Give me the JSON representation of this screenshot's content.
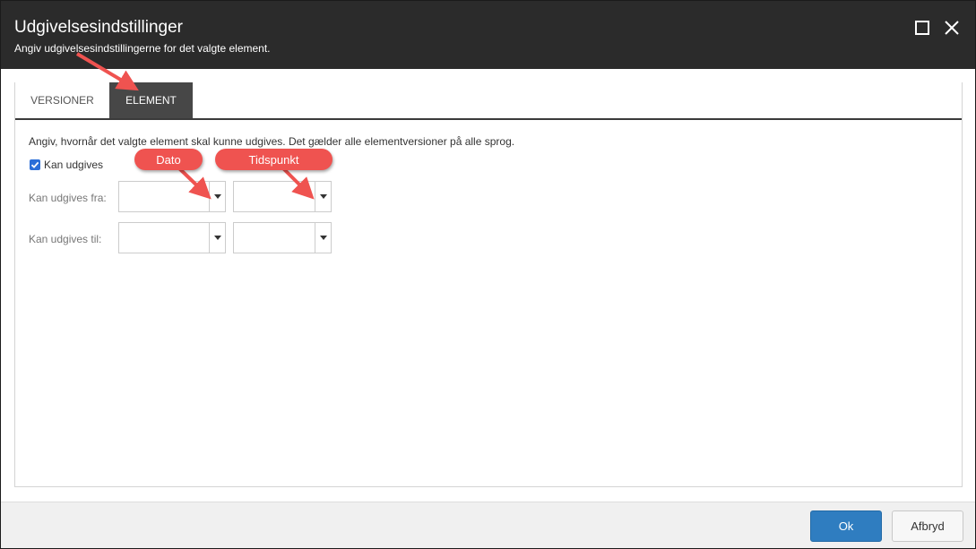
{
  "window": {
    "title": "Udgivelsesindstillinger",
    "subtitle": "Angiv udgivelsesindstillingerne for det valgte element."
  },
  "tabs": [
    {
      "label": "VERSIONER",
      "active": false
    },
    {
      "label": "ELEMENT",
      "active": true
    }
  ],
  "main": {
    "description": "Angiv, hvornår det valgte element skal kunne udgives. Det gælder alle elementversioner på alle sprog.",
    "publishable": {
      "label": "Kan udgives",
      "checked": true
    },
    "from": {
      "label": "Kan udgives fra:",
      "date": "",
      "time": ""
    },
    "to": {
      "label": "Kan udgives til:",
      "date": "",
      "time": ""
    }
  },
  "callouts": {
    "date": "Dato",
    "time": "Tidspunkt"
  },
  "footer": {
    "ok_label": "Ok",
    "cancel_label": "Afbryd"
  },
  "icons": {
    "maximize": "maximize-icon",
    "close": "close-icon",
    "dropdown": "caret-down-icon",
    "checkbox": "checkmark-icon"
  },
  "colors": {
    "titlebar": "#2b2b2b",
    "active_tab": "#474747",
    "ok_button": "#2f7dc0",
    "checkbox": "#2a6ed8",
    "callout": "#ef5350"
  }
}
